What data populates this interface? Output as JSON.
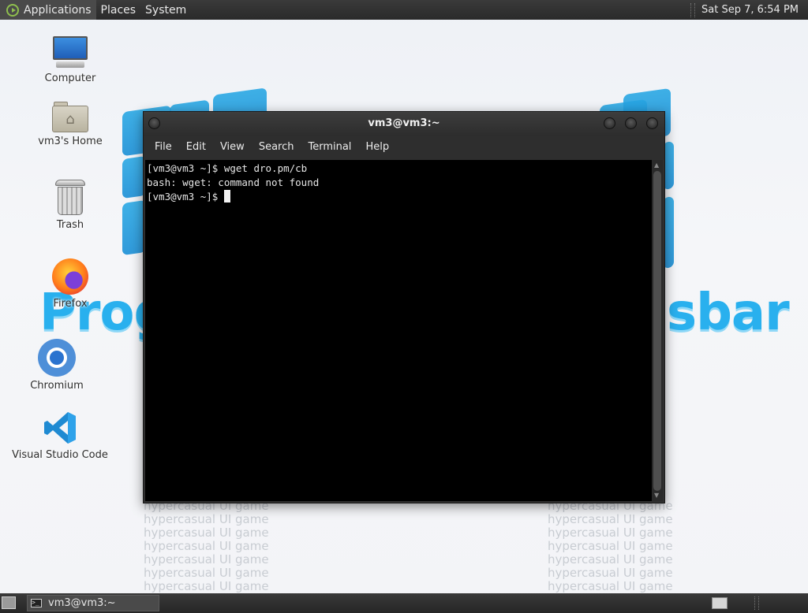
{
  "top_panel": {
    "menus": [
      "Applications",
      "Places",
      "System"
    ],
    "clock": "Sat Sep  7,  6:54 PM"
  },
  "wallpaper": {
    "left_word": "Prog",
    "right_word": "sbar",
    "watermark": "hypercasual UI game"
  },
  "desktop_icons": [
    {
      "label": "Computer",
      "icon": "computer-icon"
    },
    {
      "label": "vm3's Home",
      "icon": "home-folder-icon"
    },
    {
      "label": "Trash",
      "icon": "trash-icon"
    },
    {
      "label": "Firefox",
      "icon": "firefox-icon"
    },
    {
      "label": "Chromium",
      "icon": "chromium-icon"
    },
    {
      "label": "Visual Studio Code",
      "icon": "vscode-icon"
    }
  ],
  "terminal": {
    "title": "vm3@vm3:~",
    "menu": [
      "File",
      "Edit",
      "View",
      "Search",
      "Terminal",
      "Help"
    ],
    "lines": [
      "[vm3@vm3 ~]$ wget dro.pm/cb",
      "bash: wget: command not found",
      "[vm3@vm3 ~]$ "
    ]
  },
  "bottom_panel": {
    "task_label": "vm3@vm3:~"
  },
  "colors": {
    "panel": "#2f2f2f",
    "terminal_bg": "#000000",
    "terminal_fg": "#e6e6e6",
    "accent_blue": "#29b0ee"
  }
}
